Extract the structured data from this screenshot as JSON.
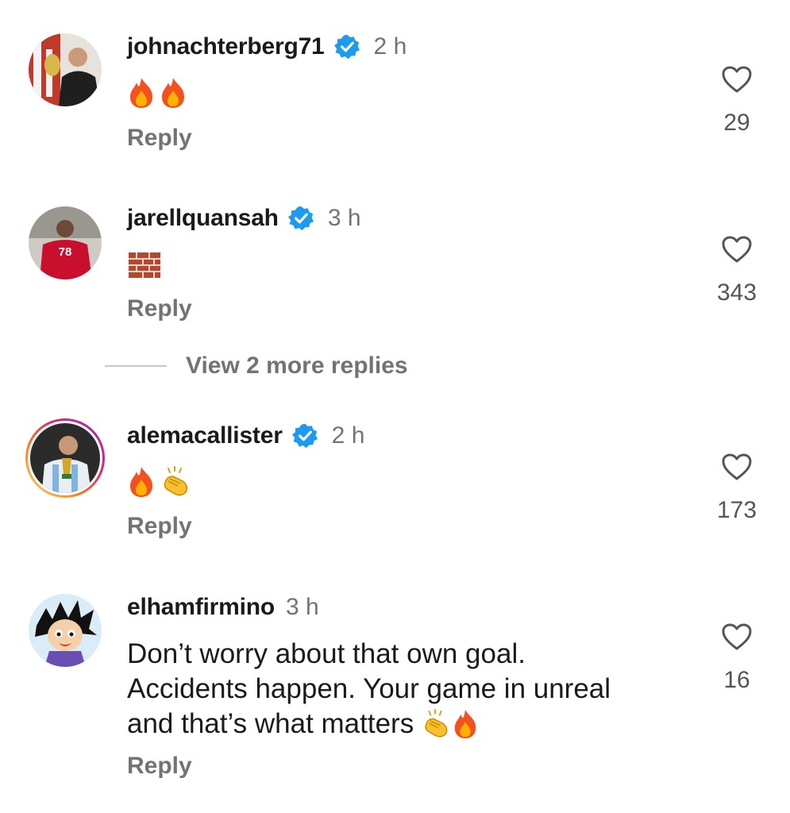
{
  "comments": [
    {
      "username": "johnachterberg71",
      "time": "2 h",
      "verified": true,
      "reply_label": "Reply",
      "likes": "29",
      "emojis": [
        "fire",
        "fire"
      ]
    },
    {
      "username": "jarellquansah",
      "time": "3 h",
      "verified": true,
      "reply_label": "Reply",
      "likes": "343",
      "emojis": [
        "brick"
      ],
      "view_more": "View 2 more replies"
    },
    {
      "username": "alemacallister",
      "time": "2 h",
      "verified": true,
      "reply_label": "Reply",
      "likes": "173",
      "emojis": [
        "fire",
        "clapping-hands"
      ]
    },
    {
      "username": "elhamfirmino",
      "time": "3 h",
      "verified": false,
      "reply_label": "Reply",
      "likes": "16",
      "text_line1": "Don’t worry about that own goal.",
      "text_line2": "Accidents happen. Your game in unreal",
      "text_line3": "and that’s what matters",
      "emojis": [
        "clapping-hands",
        "fire"
      ]
    }
  ],
  "colors": {
    "verified_blue": "#1d9bf0",
    "secondary_text": "#737373",
    "primary_text": "#1a1a1a"
  }
}
